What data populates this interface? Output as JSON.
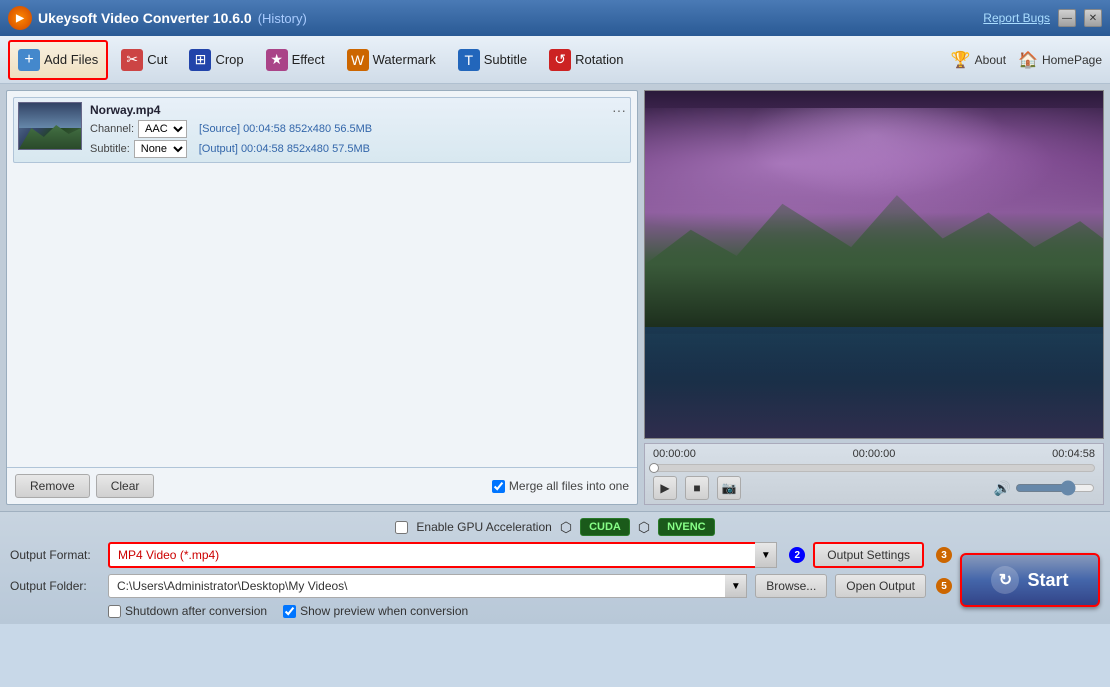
{
  "titleBar": {
    "logo": "▶",
    "title": "Ukeysoft Video Converter 10.6.0",
    "history": "(History)",
    "reportBugs": "Report Bugs",
    "minimize": "—",
    "close": "✕"
  },
  "toolbar": {
    "addFiles": "Add Files",
    "cut": "Cut",
    "crop": "Crop",
    "effect": "Effect",
    "watermark": "Watermark",
    "subtitle": "Subtitle",
    "rotation": "Rotation",
    "about": "About",
    "homePage": "HomePage"
  },
  "fileList": {
    "fileName": "Norway.mp4",
    "channelLabel": "Channel:",
    "channelValue": "AAC",
    "subtitleLabel": "Subtitle:",
    "subtitleValue": "None",
    "sourceInfo": "[Source]  00:04:58  852x480  56.5MB",
    "outputInfo": "[Output]  00:04:58  852x480  57.5MB",
    "removeBtn": "Remove",
    "clearBtn": "Clear",
    "mergeCheckLabel": "Merge all files into one"
  },
  "videoControls": {
    "timeStart": "00:00:00",
    "timeMid": "00:00:00",
    "timeEnd": "00:04:58"
  },
  "gpuRow": {
    "checkLabel": "Enable GPU Acceleration",
    "cudaLabel": "CUDA",
    "nvencLabel": "NVENC"
  },
  "outputFormat": {
    "label": "Output Format:",
    "value": "MP4 Video (*.mp4)",
    "badgeNum": "2",
    "settingsBtn": "Output Settings",
    "settingsBadge": "3"
  },
  "outputFolder": {
    "label": "Output Folder:",
    "path": "C:\\Users\\Administrator\\Desktop\\My Videos\\",
    "browseBtn": "Browse...",
    "openOutputBtn": "Open Output",
    "actionsBadge": "5"
  },
  "options": {
    "shutdownLabel": "Shutdown after conversion",
    "previewLabel": "Show preview when conversion"
  },
  "startBtn": {
    "icon": "↻",
    "label": "Start"
  }
}
